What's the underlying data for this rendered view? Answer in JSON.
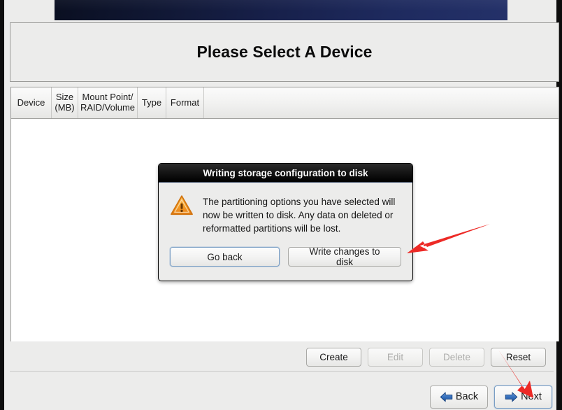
{
  "window": {
    "title": "Please Select A Device"
  },
  "banner": {
    "name": "installer-banner",
    "gradient_from": "#0a0f21",
    "gradient_to": "#243169"
  },
  "table": {
    "columns": [
      {
        "label": "Device",
        "width": 58
      },
      {
        "label": "Size\n(MB)",
        "width": 38
      },
      {
        "label": "Mount Point/\nRAID/Volume",
        "width": 85
      },
      {
        "label": "Type",
        "width": 41
      },
      {
        "label": "Format",
        "width": 54
      }
    ],
    "rows": []
  },
  "action_buttons": [
    {
      "label": "Create",
      "name": "create-button",
      "disabled": false
    },
    {
      "label": "Edit",
      "name": "edit-button",
      "disabled": true
    },
    {
      "label": "Delete",
      "name": "delete-button",
      "disabled": true
    },
    {
      "label": "Reset",
      "name": "reset-button",
      "disabled": false
    }
  ],
  "navigation": {
    "back": {
      "label": "Back",
      "icon": "arrow-left-icon",
      "focused": false
    },
    "next": {
      "label": "Next",
      "icon": "arrow-right-icon",
      "focused": true
    },
    "arrow_color": "#2b62b0"
  },
  "dialog": {
    "title": "Writing storage configuration to disk",
    "icon": "warning-triangle-icon",
    "message": "The partitioning options you have selected will now be written to disk.  Any data on deleted or reformatted partitions will be lost.",
    "buttons": [
      {
        "label": "Go back",
        "name": "go-back-button",
        "focused": true
      },
      {
        "label": "Write changes to disk",
        "name": "write-changes-to-disk-button",
        "focused": false
      }
    ],
    "icon_color": "#f0941e"
  },
  "annotations": {
    "color": "#ed2a26",
    "arrows": [
      {
        "name": "annotation-arrow-write-changes",
        "points_to": "write-changes-to-disk-button"
      },
      {
        "name": "annotation-arrow-next",
        "points_to": "next-button"
      }
    ]
  }
}
